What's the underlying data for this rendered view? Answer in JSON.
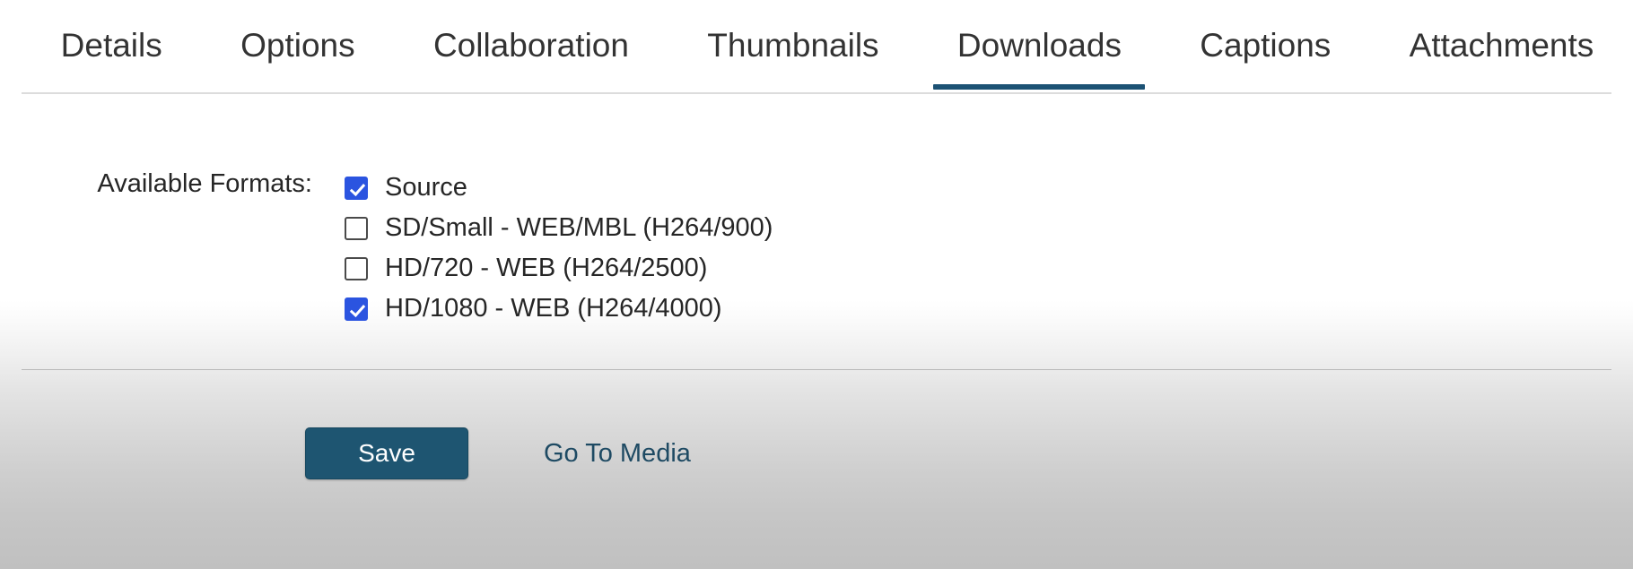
{
  "tabs": [
    {
      "label": "Details",
      "active": false
    },
    {
      "label": "Options",
      "active": false
    },
    {
      "label": "Collaboration",
      "active": false
    },
    {
      "label": "Thumbnails",
      "active": false
    },
    {
      "label": "Downloads",
      "active": true
    },
    {
      "label": "Captions",
      "active": false
    },
    {
      "label": "Attachments",
      "active": false
    }
  ],
  "form": {
    "formats_label": "Available Formats:",
    "formats": [
      {
        "label": "Source",
        "checked": true
      },
      {
        "label": "SD/Small - WEB/MBL (H264/900)",
        "checked": false
      },
      {
        "label": "HD/720 - WEB (H264/2500)",
        "checked": false
      },
      {
        "label": "HD/1080 - WEB (H264/4000)",
        "checked": true
      }
    ]
  },
  "footer": {
    "save_label": "Save",
    "go_to_media_label": "Go To Media"
  },
  "colors": {
    "active_tab_underline": "#1c5274",
    "checkbox_checked": "#2b54e0",
    "save_button_bg": "#1e5571",
    "link_text": "#1e4a63",
    "tab_text": "#333333",
    "body_text": "#262626"
  }
}
